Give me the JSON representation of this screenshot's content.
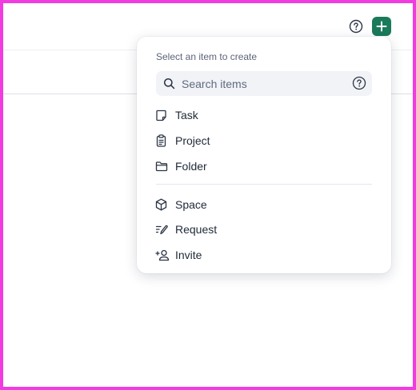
{
  "header": {
    "help_icon": "help-circle-icon",
    "add_icon": "plus-icon",
    "accent": "#1a7a5a"
  },
  "menu": {
    "title": "Select an item to create",
    "search": {
      "placeholder": "Search items",
      "icon": "search-icon",
      "help_icon": "help-circle-icon"
    },
    "groups": [
      [
        {
          "label": "Task",
          "icon": "task-icon"
        },
        {
          "label": "Project",
          "icon": "clipboard-icon"
        },
        {
          "label": "Folder",
          "icon": "folder-icon"
        }
      ],
      [
        {
          "label": "Space",
          "icon": "cube-icon"
        },
        {
          "label": "Request",
          "icon": "request-icon"
        },
        {
          "label": "Invite",
          "icon": "add-user-icon"
        }
      ]
    ]
  }
}
